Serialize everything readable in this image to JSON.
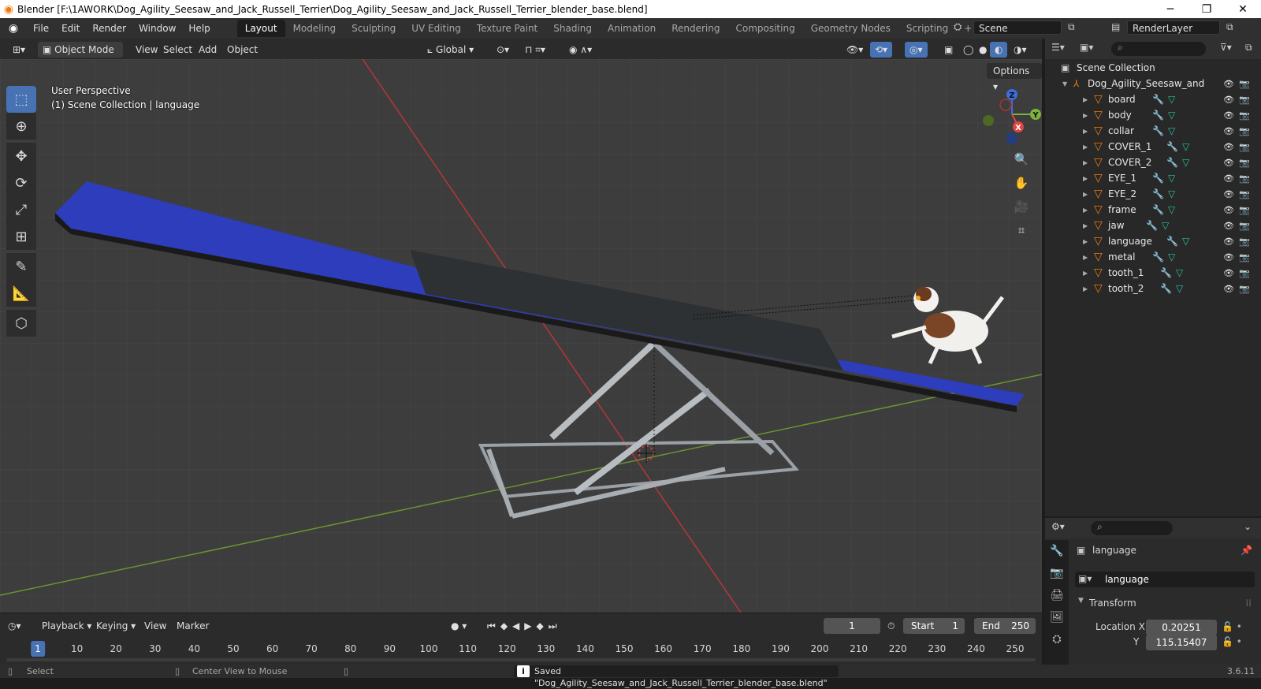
{
  "window": {
    "title": "Blender [F:\\1AWORK\\Dog_Agility_Seesaw_and_Jack_Russell_Terrier\\Dog_Agility_Seesaw_and_Jack_Russell_Terrier_blender_base.blend]"
  },
  "menu": [
    "File",
    "Edit",
    "Render",
    "Window",
    "Help"
  ],
  "workspaces": [
    "Layout",
    "Modeling",
    "Sculpting",
    "UV Editing",
    "Texture Paint",
    "Shading",
    "Animation",
    "Rendering",
    "Compositing",
    "Geometry Nodes",
    "Scripting"
  ],
  "active_workspace": "Layout",
  "scene": {
    "label": "Scene",
    "render_layer": "RenderLayer"
  },
  "viewport_header": {
    "mode": "Object Mode",
    "menus": [
      "View",
      "Select",
      "Add",
      "Object"
    ],
    "transform_orientation": "Global"
  },
  "viewport": {
    "perspective": "User Perspective",
    "collection_info": "(1) Scene Collection | language",
    "options_label": "Options",
    "gizmo_axes": {
      "x": "X",
      "y": "Y",
      "z": "Z"
    }
  },
  "outliner": {
    "root": "Scene Collection",
    "collection": "Dog_Agility_Seesaw_and_Jac",
    "objects": [
      "board",
      "body",
      "collar",
      "COVER_1",
      "COVER_2",
      "EYE_1",
      "EYE_2",
      "frame",
      "jaw",
      "language",
      "metal",
      "tooth_1",
      "tooth_2"
    ],
    "active_object": "language"
  },
  "properties": {
    "object_name": "language",
    "data_name": "language",
    "panel": "Transform",
    "location_label": "Location X",
    "location_x": "0.20251",
    "location_y_label": "Y",
    "location_y": "115.15407"
  },
  "timeline": {
    "menus": [
      "Playback",
      "Keying",
      "View",
      "Marker"
    ],
    "current_frame": "1",
    "start_label": "Start",
    "start": "1",
    "end_label": "End",
    "end": "250",
    "ticks": [
      "1",
      "10",
      "20",
      "30",
      "40",
      "50",
      "60",
      "70",
      "80",
      "90",
      "100",
      "110",
      "120",
      "130",
      "140",
      "150",
      "160",
      "170",
      "180",
      "190",
      "200",
      "210",
      "220",
      "230",
      "240",
      "250"
    ]
  },
  "status": {
    "select": "Select",
    "center_view": "Center View to Mouse",
    "message": "Saved \"Dog_Agility_Seesaw_and_Jack_Russell_Terrier_blender_base.blend\"",
    "version": "3.6.11"
  },
  "colors": {
    "accent": "#4772b3",
    "object_orange": "#e87d0d",
    "modifier_blue": "#6a9ee8",
    "mesh_green": "#28c2a0"
  }
}
